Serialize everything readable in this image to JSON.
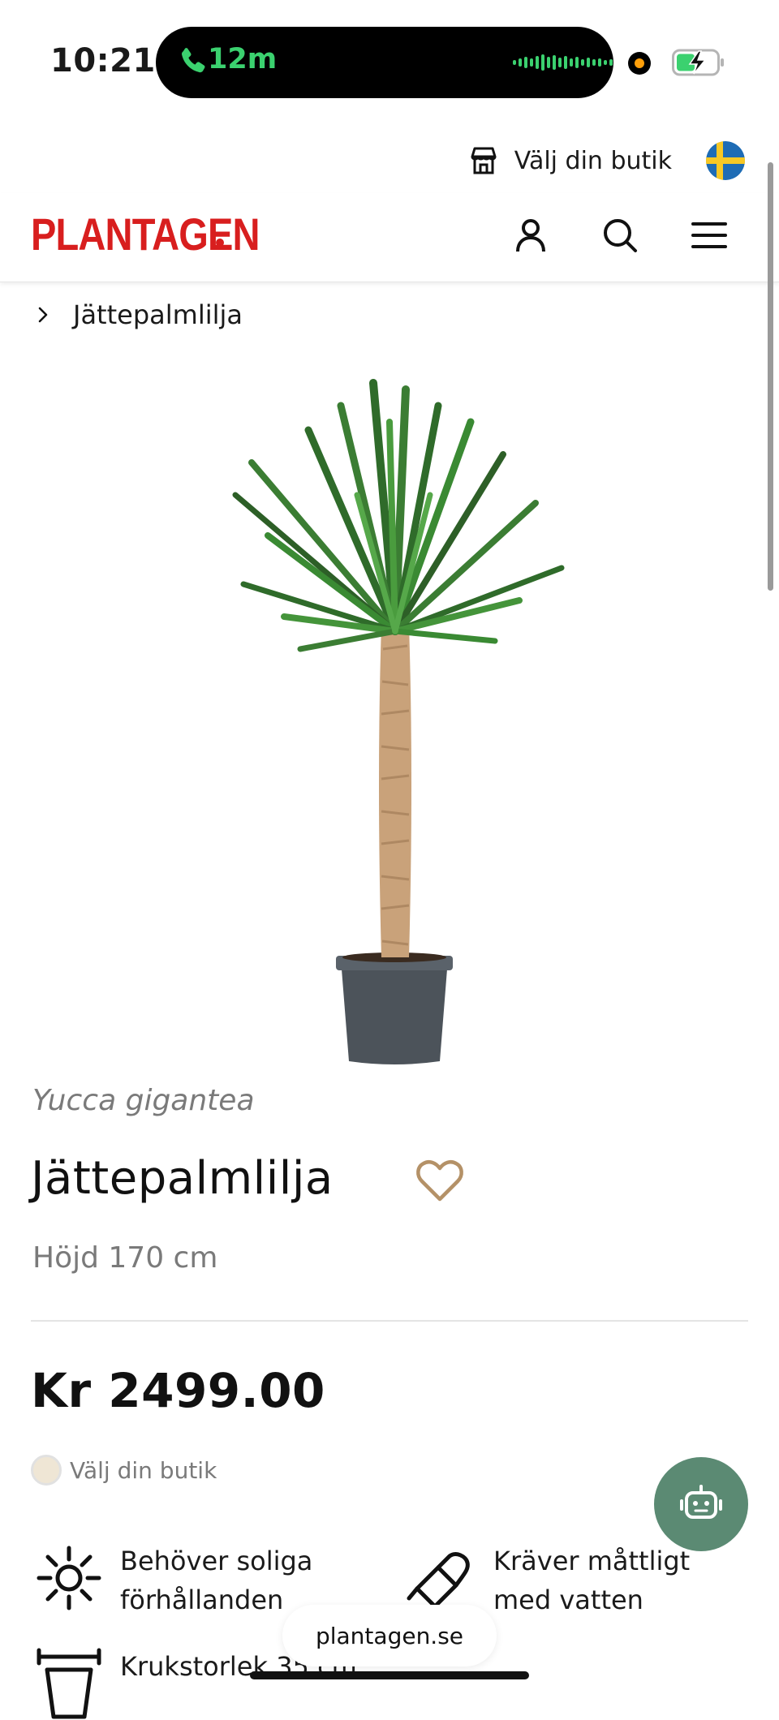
{
  "status_bar": {
    "time": "10:21",
    "call_duration": "12m",
    "accent": "#3bd16f"
  },
  "store_selector": {
    "label": "Välj din butik",
    "icon": "store-icon",
    "flag": "sweden-flag-icon"
  },
  "header": {
    "logo_text": "PLANTAGEN",
    "logo_color": "#d81e1e",
    "icons": [
      "account-icon",
      "search-icon",
      "menu-icon"
    ]
  },
  "breadcrumb": {
    "items": [
      "Jättepalmlilja"
    ]
  },
  "product": {
    "latin_name": "Yucca gigantea",
    "name": "Jättepalmlilja",
    "height": "Höjd 170 cm",
    "price": "Kr 2499.00",
    "stock_label": "Välj din butik"
  },
  "care": [
    {
      "icon": "sun-icon",
      "lines": [
        "Behöver soliga",
        "förhållanden"
      ]
    },
    {
      "icon": "watering-can-icon",
      "lines": [
        "Kräver måttligt",
        "med vatten"
      ]
    },
    {
      "icon": "pot-icon",
      "lines": [
        "Krukstorlek 35 cm"
      ]
    }
  ],
  "chat": {
    "icon": "chatbot-icon",
    "color": "#5b8a73"
  },
  "browser": {
    "url": "plantagen.se"
  }
}
